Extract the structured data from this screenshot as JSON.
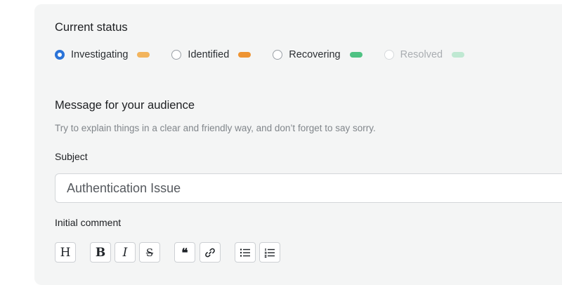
{
  "status_section": {
    "title": "Current status",
    "options": [
      {
        "label": "Investigating",
        "checked": true,
        "disabled": false,
        "color": "#f2b45d"
      },
      {
        "label": "Identified",
        "checked": false,
        "disabled": false,
        "color": "#ee9433"
      },
      {
        "label": "Recovering",
        "checked": false,
        "disabled": false,
        "color": "#4fc283"
      },
      {
        "label": "Resolved",
        "checked": false,
        "disabled": true,
        "color": "#bfe8d2"
      }
    ]
  },
  "message_section": {
    "title": "Message for your audience",
    "hint": "Try to explain things in a clear and friendly way, and don’t forget to say sorry.",
    "subject_label": "Subject",
    "subject_value": "Authentication Issue",
    "comment_label": "Initial comment"
  },
  "toolbar": {
    "heading_glyph": "H",
    "bold_glyph": "B",
    "italic_glyph": "I",
    "strike_glyph": "S",
    "quote_glyph": "❝"
  },
  "colors": {
    "accent": "#2a73d8",
    "panel_bg": "#f4f5f5"
  }
}
